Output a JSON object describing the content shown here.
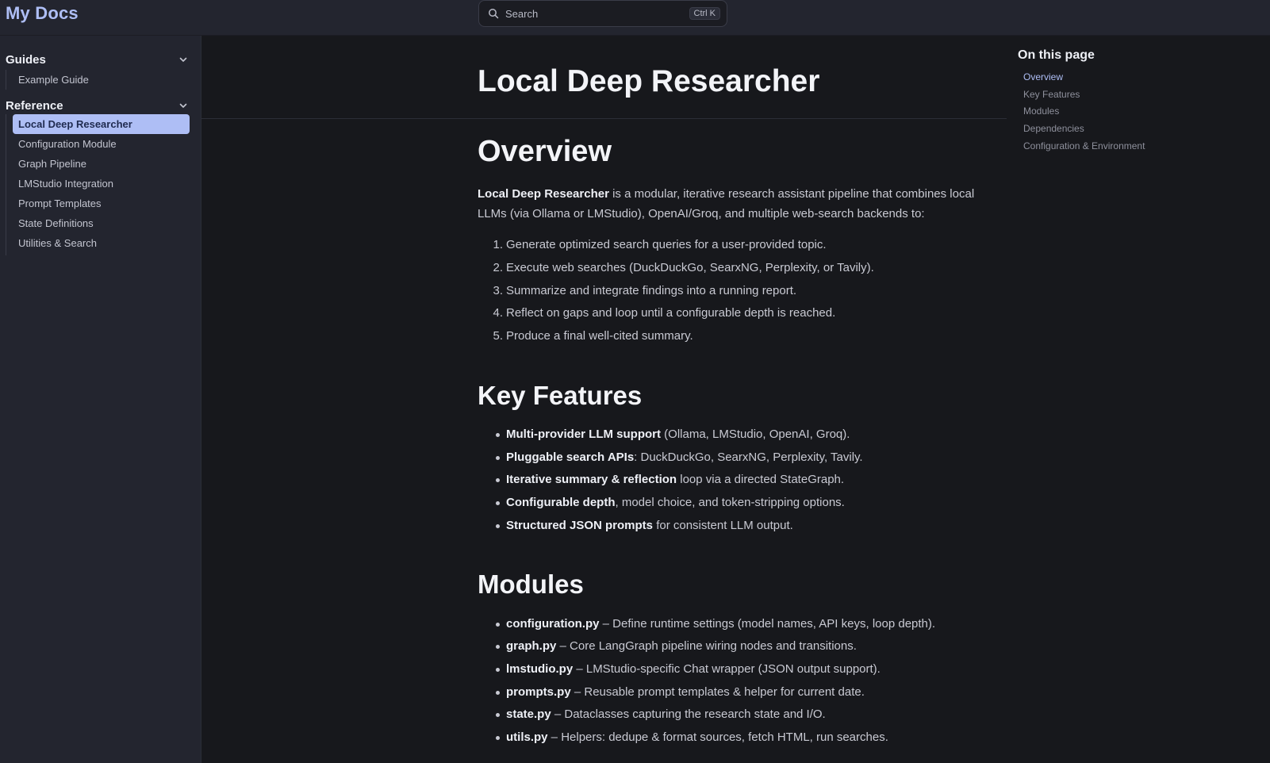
{
  "header": {
    "site_title": "My Docs",
    "search": {
      "label": "Search",
      "shortcut": "Ctrl K"
    }
  },
  "sidebar": {
    "groups": [
      {
        "title": "Guides",
        "items": [
          {
            "label": "Example Guide"
          }
        ]
      },
      {
        "title": "Reference",
        "items": [
          {
            "label": "Local Deep Researcher",
            "active": true
          },
          {
            "label": "Configuration Module"
          },
          {
            "label": "Graph Pipeline"
          },
          {
            "label": "LMStudio Integration"
          },
          {
            "label": "Prompt Templates"
          },
          {
            "label": "State Definitions"
          },
          {
            "label": "Utilities & Search"
          }
        ]
      }
    ]
  },
  "main": {
    "page_title": "Local Deep Researcher",
    "overview": {
      "heading": "Overview",
      "intro_bold": "Local Deep Researcher",
      "intro_rest": " is a modular, iterative research assistant pipeline that combines local LLMs (via Ollama or LMStudio), OpenAI/Groq, and multiple web-search backends to:",
      "steps": [
        {
          "num": "1.",
          "text": "Generate optimized search queries for a user-provided topic."
        },
        {
          "num": "2.",
          "text": "Execute web searches (DuckDuckGo, SearxNG, Perplexity, or Tavily)."
        },
        {
          "num": "3.",
          "text": "Summarize and integrate findings into a running report."
        },
        {
          "num": "4.",
          "text": "Reflect on gaps and loop until a configurable depth is reached."
        },
        {
          "num": "5.",
          "text": "Produce a final well-cited summary."
        }
      ]
    },
    "key_features": {
      "heading": "Key Features",
      "items": [
        {
          "bold": "Multi-provider LLM support",
          "rest": " (Ollama, LMStudio, OpenAI, Groq)."
        },
        {
          "bold": "Pluggable search APIs",
          "rest": ": DuckDuckGo, SearxNG, Perplexity, Tavily."
        },
        {
          "bold": "Iterative summary & reflection",
          "rest": " loop via a directed StateGraph."
        },
        {
          "bold": "Configurable depth",
          "rest": ", model choice, and token-stripping options."
        },
        {
          "bold": "Structured JSON prompts",
          "rest": " for consistent LLM output."
        }
      ]
    },
    "modules": {
      "heading": "Modules",
      "items": [
        {
          "bold": "configuration.py",
          "rest": " – Define runtime settings (model names, API keys, loop depth)."
        },
        {
          "bold": "graph.py",
          "rest": " – Core LangGraph pipeline wiring nodes and transitions."
        },
        {
          "bold": "lmstudio.py",
          "rest": " – LMStudio-specific Chat wrapper (JSON output support)."
        },
        {
          "bold": "prompts.py",
          "rest": " – Reusable prompt templates & helper for current date."
        },
        {
          "bold": "state.py",
          "rest": " – Dataclasses capturing the research state and I/O."
        },
        {
          "bold": "utils.py",
          "rest": " – Helpers: dedupe & format sources, fetch HTML, run searches."
        }
      ]
    }
  },
  "toc": {
    "title": "On this page",
    "items": [
      {
        "label": "Overview",
        "active": true
      },
      {
        "label": "Key Features"
      },
      {
        "label": "Modules"
      },
      {
        "label": "Dependencies"
      },
      {
        "label": "Configuration & Environment"
      }
    ]
  },
  "colors": {
    "accent": "#aebef5",
    "background": "#17181c",
    "sidebar": "#23252f"
  }
}
